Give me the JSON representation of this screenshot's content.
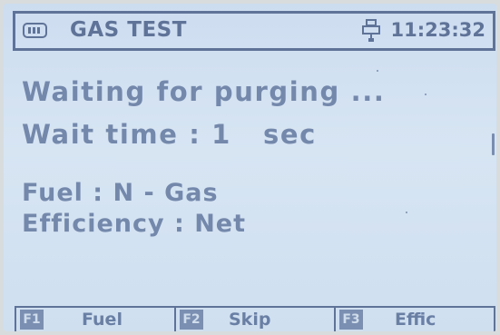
{
  "header": {
    "battery_icon": "battery-icon",
    "title": "GAS TEST",
    "connection_icon": "usb-icon",
    "time": "11:23:32"
  },
  "status": {
    "line1": "Waiting for purging ...",
    "line2": "Wait time : 1   sec"
  },
  "info": {
    "line1": "Fuel : N - Gas",
    "line2": "Efficiency : Net"
  },
  "softkeys": [
    {
      "key": "F1",
      "label": "Fuel"
    },
    {
      "key": "F2",
      "label": "Skip"
    },
    {
      "key": "F3",
      "label": "Effic"
    }
  ],
  "colors": {
    "screen_background": "#d2e1f1",
    "lcd_text": "#6a7fa4",
    "frame": "#5f7398"
  }
}
